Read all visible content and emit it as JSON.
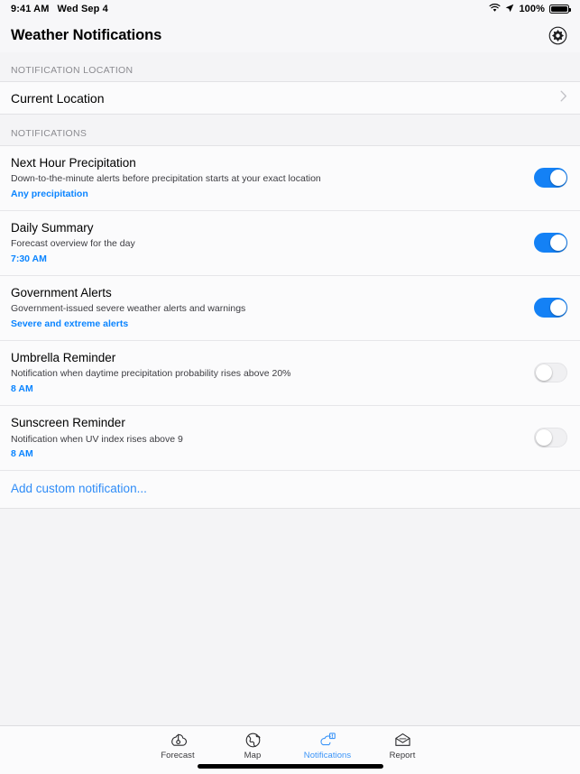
{
  "statusbar": {
    "time": "9:41 AM",
    "date": "Wed Sep 4",
    "battery_percent": "100%",
    "wifi_icon": "wifi-icon",
    "location_icon": "location-arrow-icon",
    "battery_icon": "battery-full-icon"
  },
  "navbar": {
    "title": "Weather Notifications",
    "settings_icon": "gear-icon"
  },
  "location_section": {
    "header": "NOTIFICATION LOCATION",
    "row_label": "Current Location",
    "chevron_icon": "chevron-right-icon"
  },
  "notifications_section": {
    "header": "NOTIFICATIONS",
    "items": [
      {
        "title": "Next Hour Precipitation",
        "subtitle": "Down-to-the-minute alerts before precipitation starts at your exact location",
        "value": "Any precipitation",
        "enabled": true
      },
      {
        "title": "Daily Summary",
        "subtitle": "Forecast overview for the day",
        "value": "7:30 AM",
        "enabled": true
      },
      {
        "title": "Government Alerts",
        "subtitle": "Government-issued severe weather alerts and warnings",
        "value": "Severe and extreme alerts",
        "enabled": true
      },
      {
        "title": "Umbrella Reminder",
        "subtitle": "Notification when daytime precipitation probability rises above 20%",
        "value": "8 AM",
        "enabled": false
      },
      {
        "title": "Sunscreen Reminder",
        "subtitle": "Notification when UV index rises above 9",
        "value": "8 AM",
        "enabled": false
      }
    ],
    "add_label": "Add custom notification..."
  },
  "tabbar": {
    "tabs": [
      {
        "label": "Forecast",
        "icon": "thermometer-cloud-icon",
        "active": false
      },
      {
        "label": "Map",
        "icon": "globe-icon",
        "active": false
      },
      {
        "label": "Notifications",
        "icon": "cloud-alert-icon",
        "active": true
      },
      {
        "label": "Report",
        "icon": "envelope-icon",
        "active": false
      }
    ]
  },
  "colors": {
    "accent": "#0a84ff",
    "toggle_on": "#1481f5",
    "link": "#2f8cf7",
    "tab_active": "#3a94f8",
    "page_bg": "#f4f4f6",
    "row_bg": "#fbfbfc"
  }
}
